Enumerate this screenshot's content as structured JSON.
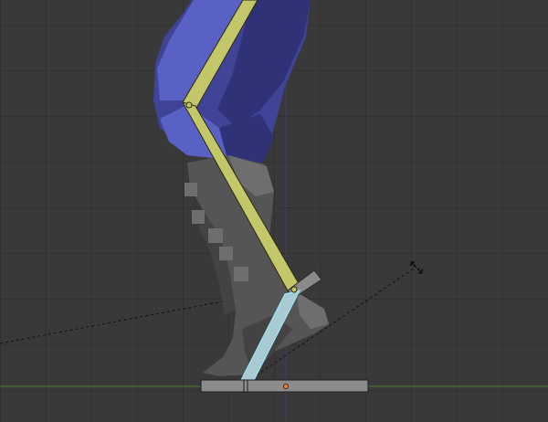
{
  "viewport": {
    "background_color": "#393939",
    "grid_line_color": "#313131",
    "ground_axis_color": "#4f7a2f",
    "vertical_axis_color": "#3f3f7a"
  },
  "scene": {
    "leg_mesh": {
      "trouser_color": "#3f4497",
      "trouser_shade_color": "#2f3276",
      "trouser_light_color": "#5a61c4",
      "boot_color": "#555555",
      "boot_light_color": "#6e6e6e",
      "boot_dark_color": "#434343"
    },
    "bones": {
      "thigh_color": "#c3c76a",
      "shin_color": "#c3c76a",
      "foot_bone_color": "#a9c9d3",
      "foot_bone_outline": "#9fe6f5",
      "bone_outline": "#2a2a10",
      "ik_handle_color": "#8a8a8a",
      "foot_controller_color": "#8b8b8b"
    },
    "origin_dot_color": "#f0821e",
    "transform_cursor_icon": "rotate-transform-icon",
    "dashed_line_color": "#111111"
  }
}
